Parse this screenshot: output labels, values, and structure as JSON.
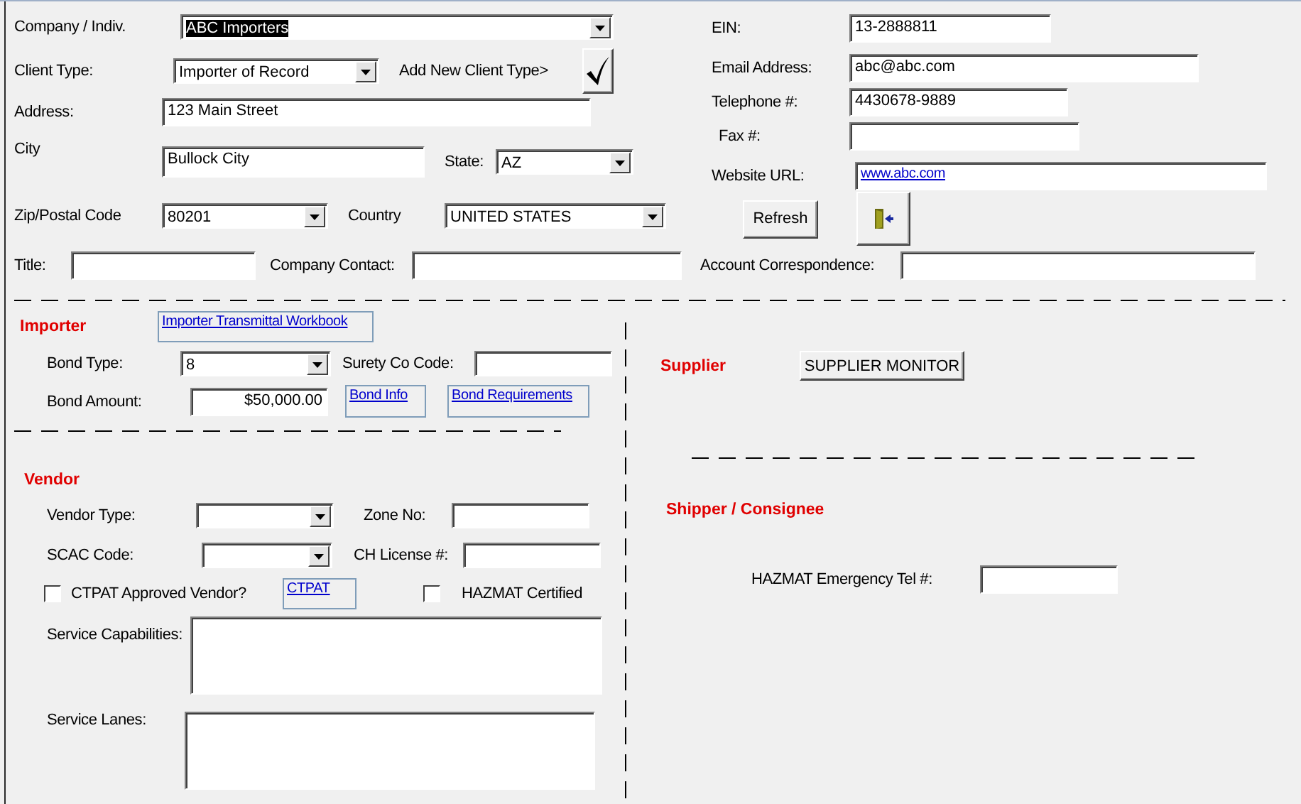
{
  "client": {
    "company": {
      "label": "Company / Indiv.",
      "value": "ABC Importers",
      "text_selected": true
    },
    "client_type": {
      "label": "Client Type:",
      "value": "Importer of Record"
    },
    "add_client_type": {
      "label": "Add New Client Type>"
    },
    "address": {
      "label": "Address:",
      "value": "123 Main Street"
    },
    "city": {
      "label": "City",
      "value": "Bullock City"
    },
    "state": {
      "label": "State:",
      "value": "AZ"
    },
    "zip": {
      "label": "Zip/Postal Code",
      "value": "80201"
    },
    "country": {
      "label": "Country",
      "value": "UNITED STATES"
    },
    "title": {
      "label": "Title:"
    },
    "company_contact": {
      "label": "Company Contact:"
    },
    "account_correspondence": {
      "label": "Account Correspondence:"
    }
  },
  "contact": {
    "ein": {
      "label": "EIN:",
      "value": "13-2888811"
    },
    "email": {
      "label": "Email Address:",
      "value": "abc@abc.com"
    },
    "telephone": {
      "label": "Telephone #:",
      "value": "4430678-9889"
    },
    "fax": {
      "label": "Fax #:"
    },
    "website": {
      "label": "Website URL:",
      "value": "www.abc.com"
    }
  },
  "buttons": {
    "refresh": "Refresh"
  },
  "importer": {
    "heading": "Importer",
    "workbook_link": "Importer Transmittal Workbook",
    "bond_type": {
      "label": "Bond Type:",
      "value": "8"
    },
    "surety": {
      "label": "Surety Co Code:"
    },
    "bond_amount": {
      "label": "Bond Amount:",
      "value": "$50,000.00"
    },
    "links": [
      "Bond Info",
      "Bond Requirements"
    ]
  },
  "vendor": {
    "heading": "Vendor",
    "vendor_type": {
      "label": "Vendor Type:"
    },
    "zone": {
      "label": "Zone No:"
    },
    "scac": {
      "label": "SCAC Code:"
    },
    "ch_license": {
      "label": "CH License #:"
    },
    "ctpat_approved": {
      "label": "CTPAT Approved Vendor?",
      "checked": false
    },
    "ctpat_link": "CTPAT",
    "hazmat": {
      "label": "HAZMAT Certified",
      "checked": false
    },
    "service_capabilities": {
      "label": "Service Capabilities:"
    },
    "service_lanes": {
      "label": "Service Lanes:"
    }
  },
  "supplier": {
    "heading": "Supplier",
    "monitor_button": "SUPPLIER MONITOR"
  },
  "shipper": {
    "heading": "Shipper / Consignee",
    "hazmat_tel": {
      "label": "HAZMAT Emergency Tel #:"
    }
  }
}
